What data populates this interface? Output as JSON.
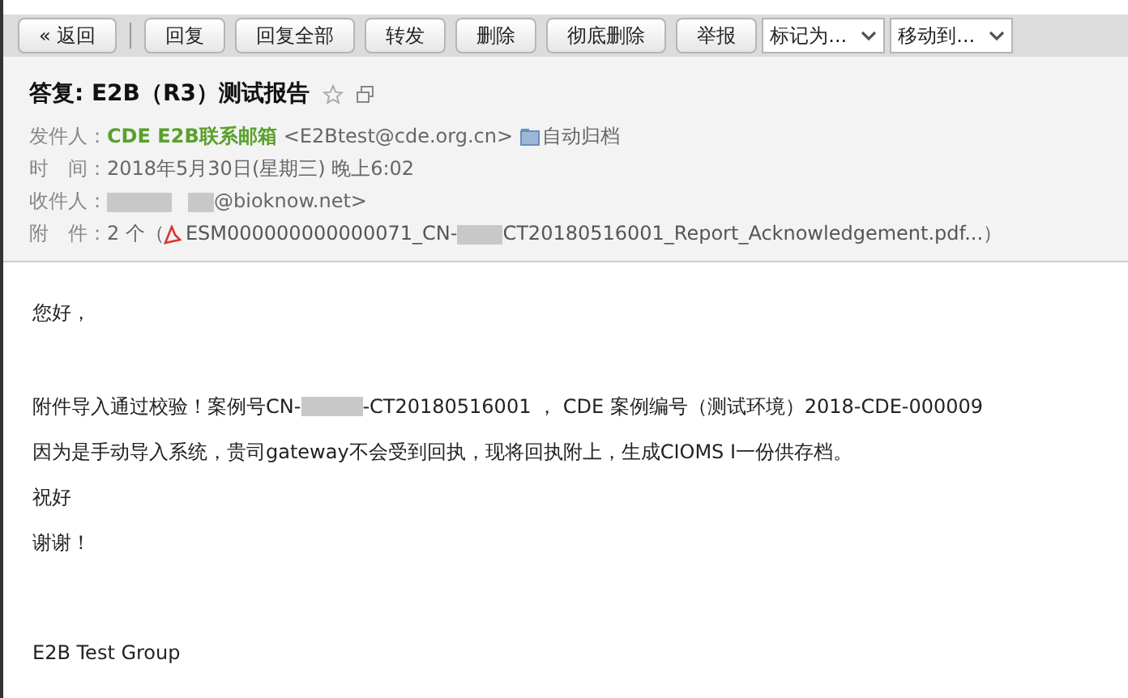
{
  "toolbar": {
    "back": "« 返回",
    "buttons": [
      "回复",
      "回复全部",
      "转发",
      "删除",
      "彻底删除",
      "举报"
    ],
    "dropdowns": [
      "标记为...",
      "移动到..."
    ]
  },
  "header": {
    "subject": "答复: E2B（R3）测试报告",
    "starred": false,
    "sender": {
      "label": "发件人：",
      "name": "CDE E2B联系邮箱",
      "address": "<E2Btest@cde.org.cn>",
      "archive": "自动归档"
    },
    "time": {
      "label": "时　间：",
      "value": "2018年5月30日(星期三) 晚上6:02"
    },
    "recipient": {
      "label": "收件人：",
      "value": "@bioknow.net>"
    },
    "attachments": {
      "label": "附　件：",
      "count": "2 个（",
      "file_start": "ESM000000000000071_CN-",
      "file_end": "CT20180516001_Report_Acknowledgement.pdf...",
      "close": "）"
    }
  },
  "body": {
    "greeting": "您好，",
    "line1_start": "附件导入通过校验！案例号CN-",
    "line1_end": "-CT20180516001 ， CDE 案例编号（测试环境）2018-CDE-000009",
    "line2": "因为是手动导入系统，贵司gateway不会受到回执，现将回执附上，生成CIOMS I一份供存档。",
    "closing": "祝好",
    "thanks": "谢谢！",
    "signature": "E2B Test Group"
  }
}
